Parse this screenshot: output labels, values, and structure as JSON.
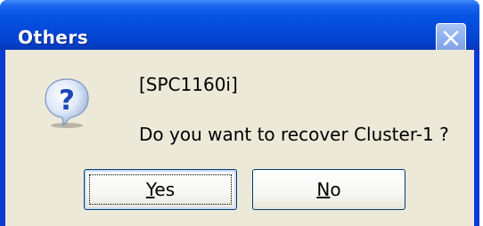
{
  "window": {
    "title": "Others",
    "close_icon": "close-icon"
  },
  "message": {
    "icon": "question-icon",
    "code": "[SPC1160i]",
    "text": "Do you want to recover Cluster-1 ?"
  },
  "buttons": {
    "yes": {
      "mnemonic": "Y",
      "rest": "es",
      "focused": true
    },
    "no": {
      "mnemonic": "N",
      "rest": "o",
      "focused": false
    }
  },
  "colors": {
    "titlebar": "#0654e4",
    "client": "#ece9d8",
    "close_button": "#8fb0ee",
    "button_border": "#003c74"
  }
}
